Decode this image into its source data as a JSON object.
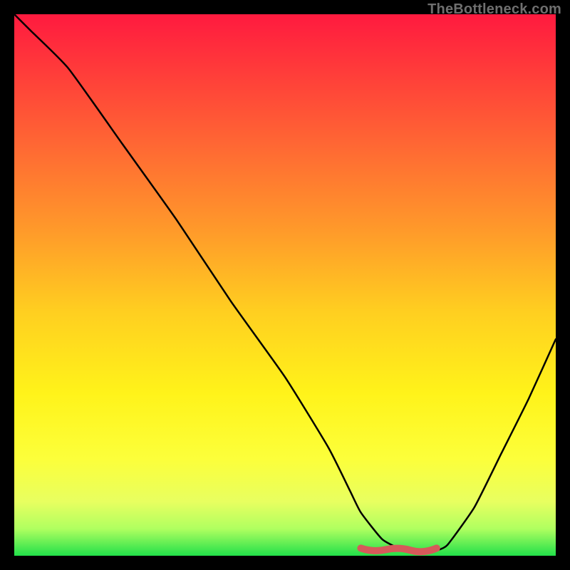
{
  "watermark": "TheBottleneck.com",
  "chart_data": {
    "type": "line",
    "title": "",
    "xlabel": "",
    "ylabel": "",
    "xlim": [
      0,
      100
    ],
    "ylim": [
      0,
      100
    ],
    "grid": false,
    "series": [
      {
        "name": "bottleneck-curve",
        "x": [
          0,
          3,
          10,
          20,
          30,
          40,
          50,
          58,
          62,
          64,
          68,
          72,
          76,
          78,
          80,
          85,
          90,
          95,
          100
        ],
        "values": [
          100,
          97,
          90,
          76,
          62,
          47,
          33,
          20,
          12,
          8,
          3,
          1,
          1,
          1,
          2,
          9,
          19,
          29,
          40
        ]
      }
    ],
    "highlight": {
      "name": "sweet-spot",
      "x_start": 64,
      "x_end": 78,
      "y": 1
    },
    "gradient_stops": [
      {
        "offset": 0.0,
        "color": "#ff1a3f"
      },
      {
        "offset": 0.1,
        "color": "#ff3a3a"
      },
      {
        "offset": 0.25,
        "color": "#ff6a33"
      },
      {
        "offset": 0.4,
        "color": "#ff9a2a"
      },
      {
        "offset": 0.55,
        "color": "#ffcf20"
      },
      {
        "offset": 0.7,
        "color": "#fff31a"
      },
      {
        "offset": 0.82,
        "color": "#fcff3a"
      },
      {
        "offset": 0.9,
        "color": "#e8ff60"
      },
      {
        "offset": 0.95,
        "color": "#b0ff60"
      },
      {
        "offset": 1.0,
        "color": "#22e04a"
      }
    ]
  }
}
